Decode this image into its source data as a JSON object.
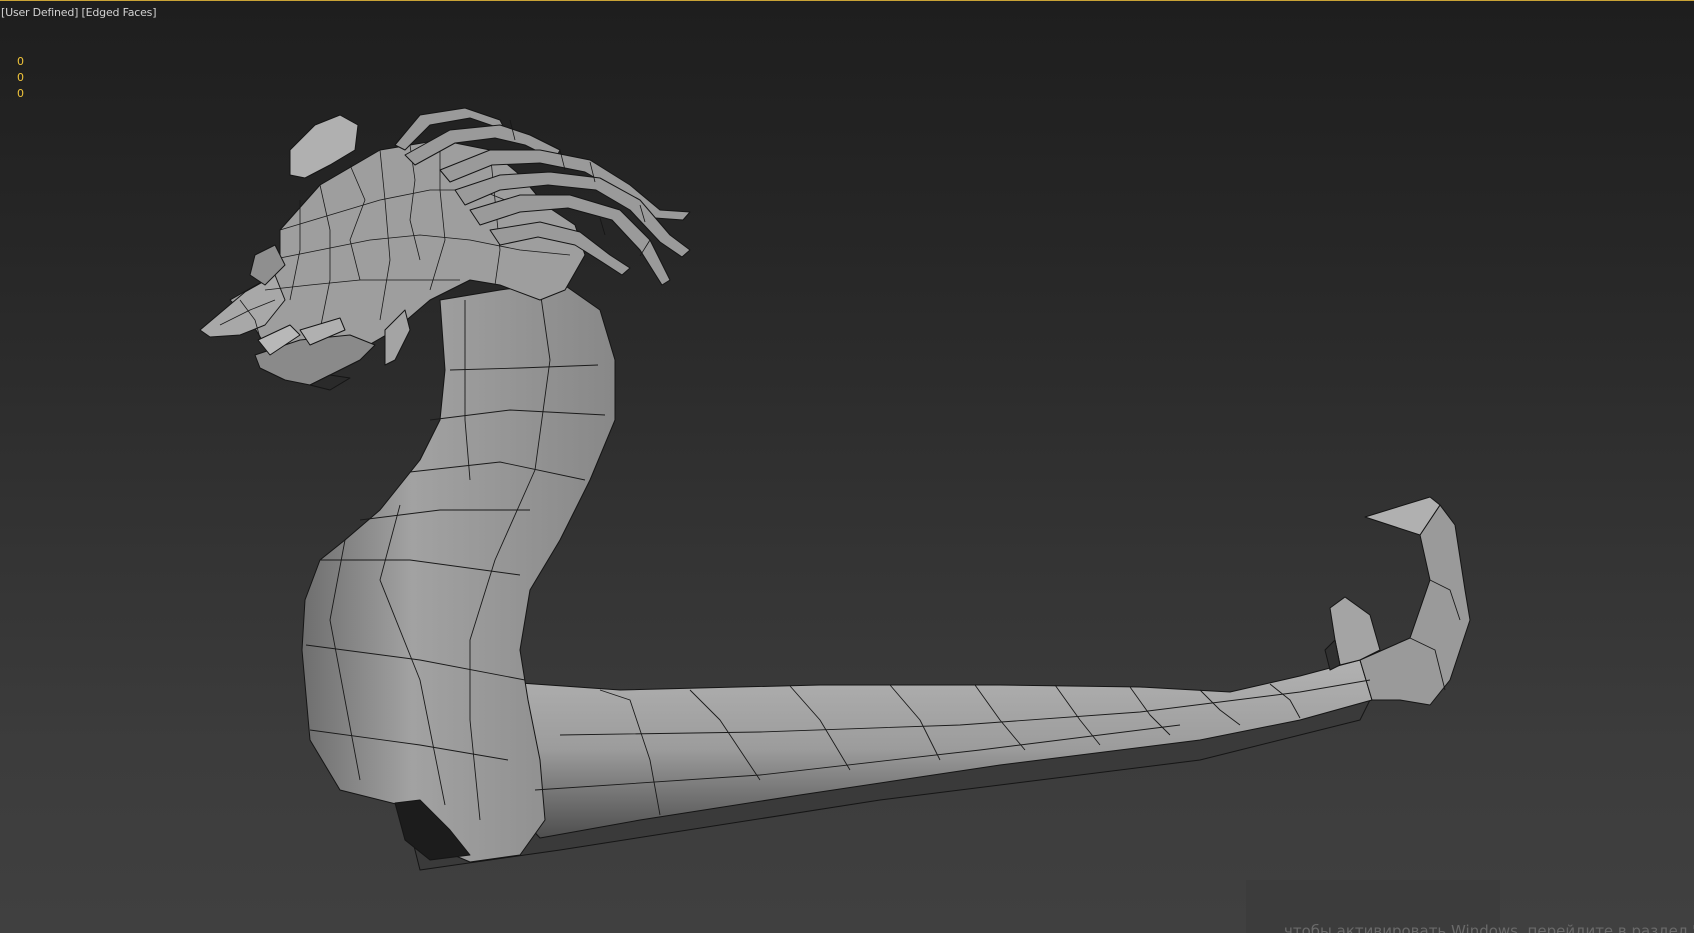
{
  "viewport": {
    "label_view": "User Defined",
    "label_shading": "Edged Faces",
    "stats": [
      "0",
      "0",
      "0"
    ],
    "accent_color": "#c9a336",
    "stats_color": "#f0c43a",
    "background_top": "#1e1e1e",
    "background_bottom": "#404040"
  },
  "model": {
    "description_icon": "sea-serpent-mesh",
    "shading": "Edged Faces",
    "material_color": "#9a9a9a"
  },
  "watermark": {
    "text": "чтобы активировать Windows, перейдите в раздел \"Пара"
  }
}
